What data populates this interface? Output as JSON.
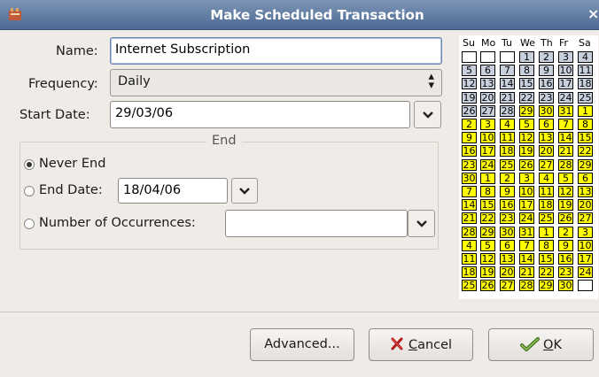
{
  "window": {
    "title": "Make Scheduled Transaction",
    "close_glyph": "×"
  },
  "form": {
    "name_label": "Name:",
    "name_value": "Internet Subscription",
    "frequency_label": "Frequency:",
    "frequency_value": "Daily",
    "start_date_label": "Start Date:",
    "start_date_value": "29/03/06"
  },
  "end_frame": {
    "title": "End",
    "never_end_label": "Never End",
    "end_date_label": "End Date:",
    "end_date_value": "18/04/06",
    "occurrences_label": "Number of Occurrences:",
    "occurrences_value": "",
    "selected": "never_end"
  },
  "calendar": {
    "weekday_headers": [
      "Su",
      "Mo",
      "Tu",
      "We",
      "Th",
      "Fr",
      "Sa"
    ],
    "rows": [
      [
        "",
        "",
        "",
        "1",
        "2",
        "3",
        "4"
      ],
      [
        "5",
        "6",
        "7",
        "8",
        "9",
        "10",
        "11"
      ],
      [
        "12",
        "13",
        "14",
        "15",
        "16",
        "17",
        "18"
      ],
      [
        "19",
        "20",
        "21",
        "22",
        "23",
        "24",
        "25"
      ],
      [
        "26",
        "27",
        "28",
        "29",
        "30",
        "31",
        "1"
      ],
      [
        "2",
        "3",
        "4",
        "5",
        "6",
        "7",
        "8"
      ],
      [
        "9",
        "10",
        "11",
        "12",
        "13",
        "14",
        "15"
      ],
      [
        "16",
        "17",
        "18",
        "19",
        "20",
        "21",
        "22"
      ],
      [
        "23",
        "24",
        "25",
        "26",
        "27",
        "28",
        "29"
      ],
      [
        "30",
        "1",
        "2",
        "3",
        "4",
        "5",
        "6"
      ],
      [
        "7",
        "8",
        "9",
        "10",
        "11",
        "12",
        "13"
      ],
      [
        "14",
        "15",
        "16",
        "17",
        "18",
        "19",
        "20"
      ],
      [
        "21",
        "22",
        "23",
        "24",
        "25",
        "26",
        "27"
      ],
      [
        "28",
        "29",
        "30",
        "31",
        "1",
        "2",
        "3"
      ],
      [
        "4",
        "5",
        "6",
        "7",
        "8",
        "9",
        "10"
      ],
      [
        "11",
        "12",
        "13",
        "14",
        "15",
        "16",
        "17"
      ],
      [
        "18",
        "19",
        "20",
        "21",
        "22",
        "23",
        "24"
      ],
      [
        "25",
        "26",
        "27",
        "28",
        "29",
        "30",
        ""
      ]
    ],
    "first_marked_row": 4,
    "first_marked_col": 3,
    "colors": {
      "marked": "#ffff00",
      "month": "#c8d0de",
      "blank": "#ffffff"
    }
  },
  "buttons": {
    "advanced_label": "Advanced...",
    "cancel_mnemonic": "C",
    "cancel_rest": "ancel",
    "ok_mnemonic": "O",
    "ok_rest": "K"
  },
  "icons": {
    "app": "app-icon",
    "cancel": "red-x-icon",
    "ok": "green-check-icon",
    "dropdown": "chevron-down-icon",
    "combo": "up-down-arrows-icon"
  }
}
